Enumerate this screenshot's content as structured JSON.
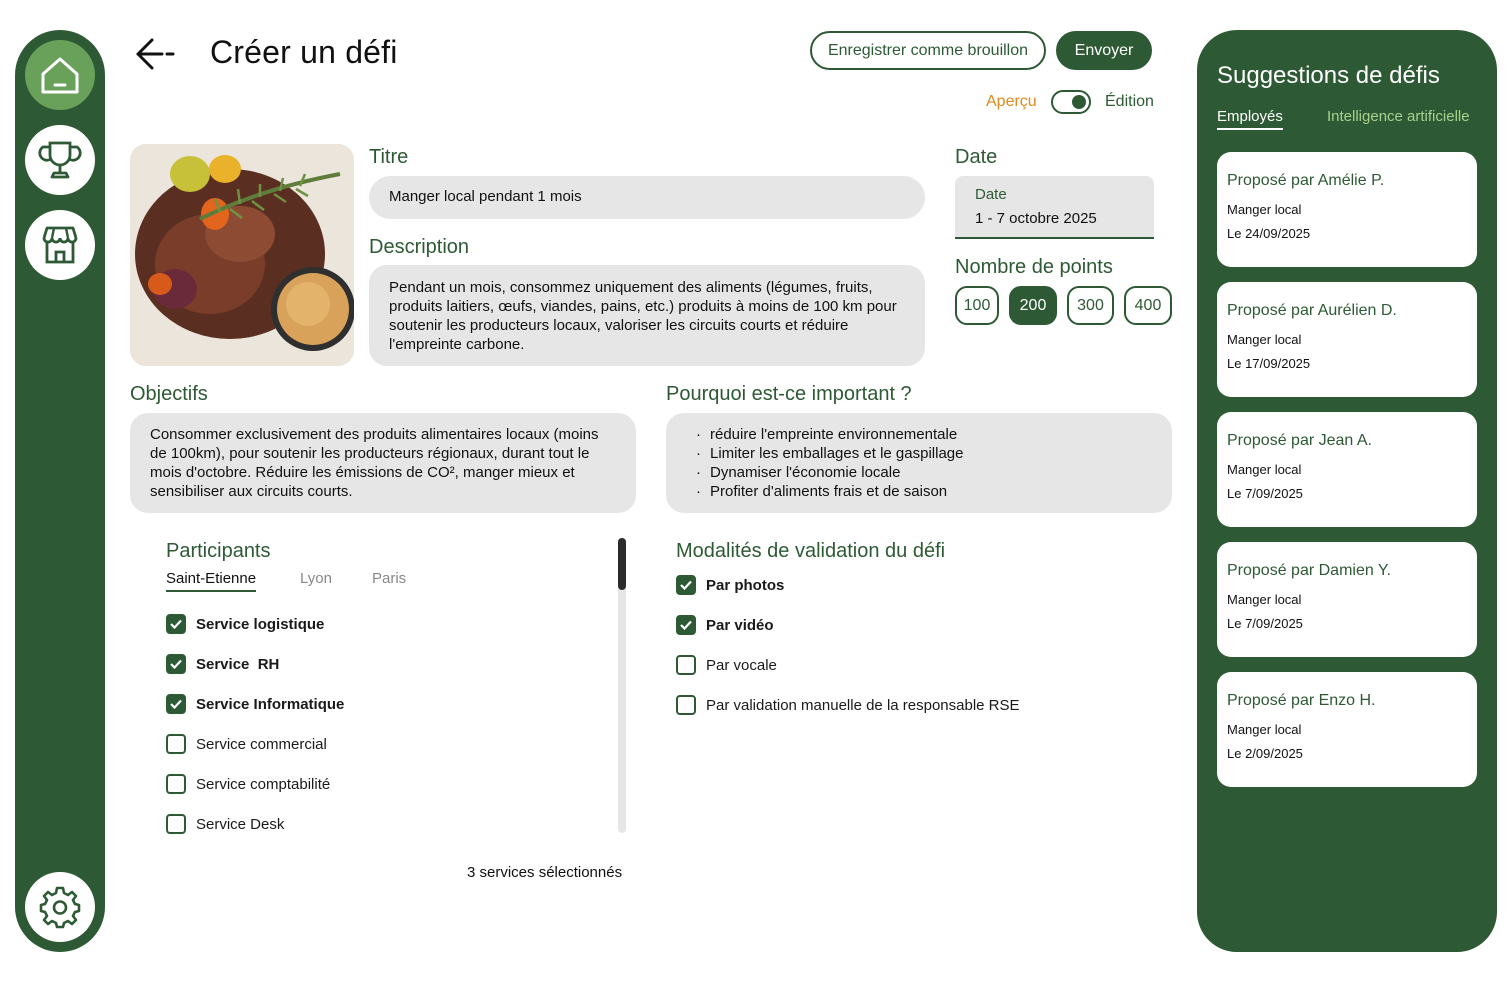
{
  "header": {
    "title": "Créer un défi",
    "draft_label": "Enregistrer comme brouillon",
    "send_label": "Envoyer",
    "preview_label": "Aperçu",
    "edit_label": "Édition"
  },
  "form": {
    "title_label": "Titre",
    "title_value": "Manger local pendant 1 mois",
    "description_label": "Description",
    "description_value": "Pendant un mois, consommez uniquement des aliments (légumes, fruits, produits laitiers, œufs, viandes, pains, etc.) produits à moins de 100 km pour soutenir les producteurs locaux, valoriser les circuits courts et réduire l'empreinte carbone.",
    "date_label": "Date",
    "date_field_label": "Date",
    "date_value": "1 - 7 octobre 2025",
    "points_label": "Nombre de points",
    "points": [
      "100",
      "200",
      "300",
      "400"
    ],
    "points_selected": "200",
    "objectives_label": "Objectifs",
    "objectives_value": "Consommer exclusivement des produits alimentaires locaux (moins de 100km), pour soutenir les producteurs régionaux, durant tout le mois d'octobre. Réduire les émissions de CO², manger mieux et sensibiliser aux circuits courts.",
    "why_label": "Pourquoi est-ce important ?",
    "why_items": [
      "réduire l'empreinte environnementale",
      "Limiter les emballages et le gaspillage",
      "Dynamiser l'économie locale",
      "Profiter d'aliments frais et de saison"
    ]
  },
  "participants": {
    "label": "Participants",
    "tabs": [
      "Saint-Etienne",
      "Lyon",
      "Paris"
    ],
    "active_tab": "Saint-Etienne",
    "services": [
      {
        "name": "Service logistique",
        "checked": true
      },
      {
        "name": "Service  RH",
        "checked": true
      },
      {
        "name": "Service Informatique",
        "checked": true
      },
      {
        "name": "Service commercial",
        "checked": false
      },
      {
        "name": "Service comptabilité",
        "checked": false
      },
      {
        "name": "Service Desk",
        "checked": false
      }
    ],
    "selected_count": "3 services sélectionnés"
  },
  "validation": {
    "label": "Modalités de validation du défi",
    "options": [
      {
        "name": "Par photos",
        "checked": true
      },
      {
        "name": "Par vidéo",
        "checked": true
      },
      {
        "name": "Par vocale",
        "checked": false
      },
      {
        "name": "Par validation manuelle de la responsable RSE",
        "checked": false
      }
    ]
  },
  "suggestions": {
    "title": "Suggestions de défis",
    "tabs": [
      "Employés",
      "Intelligence artificielle"
    ],
    "cards": [
      {
        "by": "Proposé par Amélie P.",
        "topic": "Manger local",
        "date": "Le 24/09/2025"
      },
      {
        "by": "Proposé par Aurélien D.",
        "topic": "Manger local",
        "date": "Le 17/09/2025"
      },
      {
        "by": "Proposé par Jean A.",
        "topic": "Manger local",
        "date": "Le 7/09/2025"
      },
      {
        "by": "Proposé par Damien Y.",
        "topic": "Manger local",
        "date": "Le 7/09/2025"
      },
      {
        "by": "Proposé par Enzo H.",
        "topic": "Manger local",
        "date": "Le 2/09/2025"
      }
    ]
  },
  "nav": {
    "icons": [
      "home-icon",
      "trophy-icon",
      "store-icon",
      "gear-icon"
    ]
  },
  "colors": {
    "brand_green": "#2d5a34",
    "active_nav": "#6aa15a",
    "accent_orange": "#e08a1e",
    "field_gray": "#e6e6e6"
  }
}
